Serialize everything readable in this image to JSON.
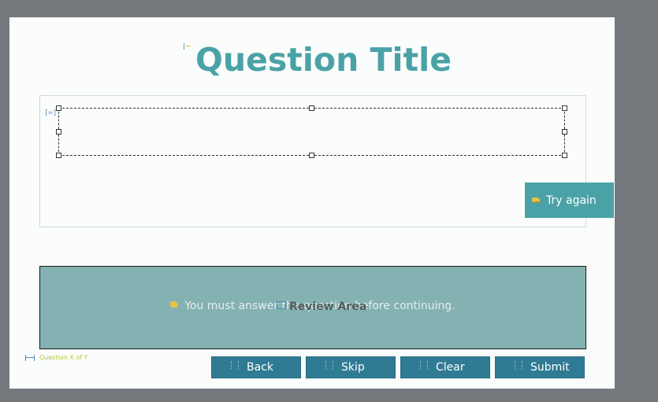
{
  "title": "Question Title",
  "feedback": {
    "try_again_label": "Try again",
    "must_answer_message": "You must answer the question before continuing."
  },
  "review_area": {
    "label": "Review Area"
  },
  "progress_label": "Question X of Y",
  "nav": {
    "back_label": "Back",
    "skip_label": "Skip",
    "clear_label": "Clear",
    "submit_label": "Submit"
  },
  "colors": {
    "accent": "#4aa2a6",
    "button": "#2f7b93",
    "review_bg": "#84b1b1",
    "progress_text": "#b5c63a",
    "backdrop": "#75787c"
  }
}
